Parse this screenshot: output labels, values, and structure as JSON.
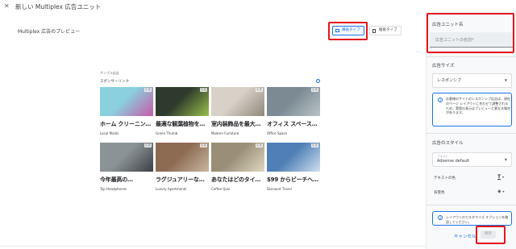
{
  "header": {
    "close_icon": "close-icon",
    "title": "新しい Multiplex 広告ユニット"
  },
  "preview": {
    "label": "Multiplex 広告のプレビュー",
    "tabs": [
      {
        "label": "横長タイプ",
        "active": true
      },
      {
        "label": "縦長タイプ",
        "active": false
      }
    ],
    "sample_label": "サンプル広告",
    "sponsored_label": "スポンサーリンク",
    "badge": "広告",
    "ads": [
      {
        "title": "ホーム クリーニン…",
        "advertiser": "Local Maids",
        "colors": [
          "#8ad0de",
          "#c75aa8"
        ]
      },
      {
        "title": "最適な観葉植物を…",
        "advertiser": "Green Thumb",
        "colors": [
          "#2e3b2c",
          "#9bbf4d"
        ]
      },
      {
        "title": "室内装飾品を最大…",
        "advertiser": "Modern Furniture",
        "colors": [
          "#d8d1c8",
          "#8f8779"
        ]
      },
      {
        "title": "オフィス スペース…",
        "advertiser": "Office Space",
        "colors": [
          "#7b8a93",
          "#b9c3c7"
        ]
      },
      {
        "title": "今年最高の…",
        "advertiser": "Top Headphones",
        "colors": [
          "#8c9397",
          "#3c3f43"
        ]
      },
      {
        "title": "ラグジュアリーな…",
        "advertiser": "Luxury Apartments",
        "colors": [
          "#8d6a52",
          "#c9b7a2"
        ]
      },
      {
        "title": "あなたはどのタイ…",
        "advertiser": "Coffee Quiz",
        "colors": [
          "#9a8f76",
          "#e0d8c4"
        ]
      },
      {
        "title": "$99 からビーチへ…",
        "advertiser": "Discount Travel",
        "colors": [
          "#4f7fb6",
          "#cfe0ef"
        ]
      }
    ]
  },
  "sidebar": {
    "ad_unit_name_label": "広告ユニット名",
    "ad_unit_name_placeholder": "広告ユニットの名前*",
    "ad_size_label": "広告サイズ",
    "ad_size_value": "レスポンシブ",
    "ad_size_info": "お客様のサイトのレスポンシブ広告は、現在のページ レイアウトに合わせて調整されるため、実際の表示はプレビューと異なる場合があります。",
    "ad_style_label": "広告のスタイル",
    "font_label": "フォント",
    "font_value": "Adsense default",
    "text_color_label": "テキストの色",
    "bg_color_label": "背景色",
    "layout_info": "レイアウトのカスタマイズ オプションを確認してください。",
    "cancel": "キャンセル",
    "save": "保存"
  },
  "colors": {
    "accent": "#1a73e8",
    "highlight": "#e6161b"
  }
}
